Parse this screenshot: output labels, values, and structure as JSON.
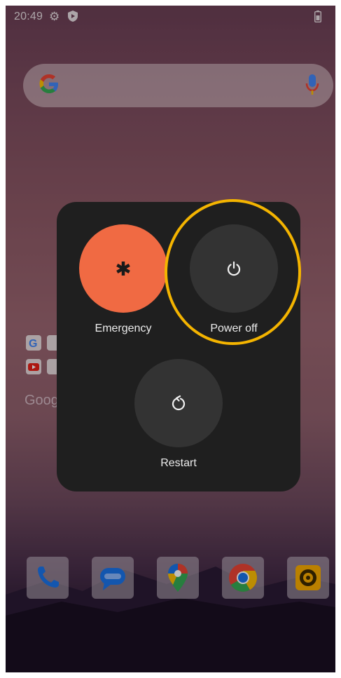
{
  "status_bar": {
    "time": "20:49",
    "icons": [
      "gear-icon",
      "shield-icon",
      "battery-icon"
    ]
  },
  "search": {
    "logo": "google-g-icon",
    "mic": "mic-icon"
  },
  "background": {
    "partial_label": "Goog"
  },
  "power_menu": {
    "emergency_label": "Emergency",
    "power_off_label": "Power off",
    "restart_label": "Restart"
  },
  "dock": {
    "apps": [
      "phone-app",
      "messages-app",
      "maps-app",
      "chrome-app",
      "camera-app"
    ]
  },
  "colors": {
    "emergency": "#f06a43",
    "menu_bg": "#1f1f1f",
    "button_bg": "#333333",
    "highlight": "#f4b400"
  }
}
